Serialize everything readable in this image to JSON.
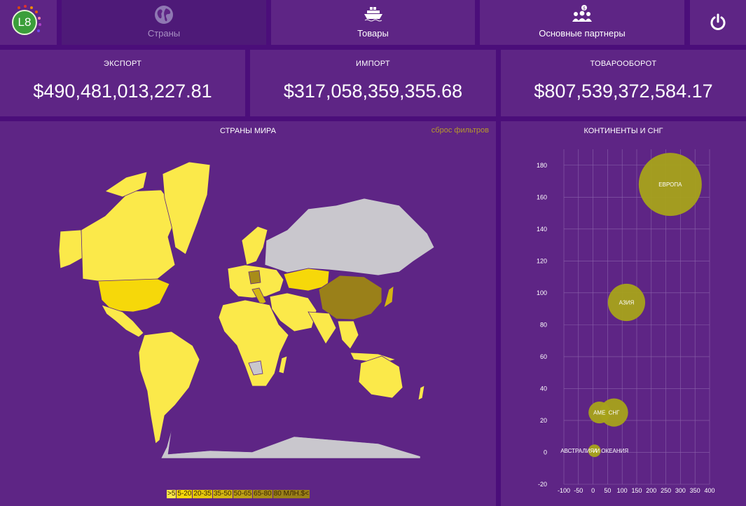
{
  "nav": {
    "tabs": [
      {
        "label": "Страны",
        "icon": "globe-icon",
        "active": true
      },
      {
        "label": "Товары",
        "icon": "cargo-ship-icon",
        "active": false
      },
      {
        "label": "Основные партнеры",
        "icon": "partners-icon",
        "active": false
      }
    ],
    "logo_text": "L8",
    "power_icon": "power-icon"
  },
  "kpis": [
    {
      "title": "ЭКСПОРТ",
      "value": "$490,481,013,227.81"
    },
    {
      "title": "ИМПОРТ",
      "value": "$317,058,359,355.68"
    },
    {
      "title": "ТОВАРООБОРОТ",
      "value": "$807,539,372,584.17"
    }
  ],
  "map": {
    "title": "СТРАНЫ МИРА",
    "reset_label": "сброс фильтров",
    "legend": [
      {
        "label": ">5",
        "color": "#fbe94a"
      },
      {
        "label": "5-20",
        "color": "#f6d80a"
      },
      {
        "label": "20-35",
        "color": "#e5c70c"
      },
      {
        "label": "35-50",
        "color": "#d3b612"
      },
      {
        "label": "50-65",
        "color": "#bda016"
      },
      {
        "label": "65-80",
        "color": "#a88c18"
      },
      {
        "label": "80 МЛН.$<",
        "color": "#9a8019"
      }
    ]
  },
  "colors": {
    "background": "#4b0e7a",
    "panel": "#5e2585",
    "bubble": "#a6a21a",
    "map_no_data": "#c9c7cd"
  },
  "chart_data": {
    "type": "scatter",
    "title": "КОНТИНЕНТЫ И СНГ",
    "xlim": [
      -100,
      400
    ],
    "ylim": [
      -20,
      190
    ],
    "x_ticks": [
      -100,
      -50,
      0,
      50,
      100,
      150,
      200,
      250,
      300,
      350,
      400
    ],
    "y_ticks": [
      -20,
      0,
      20,
      40,
      60,
      80,
      100,
      120,
      140,
      160,
      180
    ],
    "grid": true,
    "points": [
      {
        "label": "ЕВРОПА",
        "x": 265,
        "y": 168,
        "size": 100
      },
      {
        "label": "АЗИЯ",
        "x": 115,
        "y": 94,
        "size": 35
      },
      {
        "label": "АМЕ",
        "x": 22,
        "y": 25,
        "size": 12
      },
      {
        "label": "СНГ",
        "x": 72,
        "y": 25,
        "size": 20
      },
      {
        "label": "АВСТРАЛИЯ И ОКЕАНИЯ",
        "x": 5,
        "y": 1,
        "size": 4
      },
      {
        "label": "А",
        "x": 8,
        "y": 1,
        "size": 1
      }
    ]
  }
}
